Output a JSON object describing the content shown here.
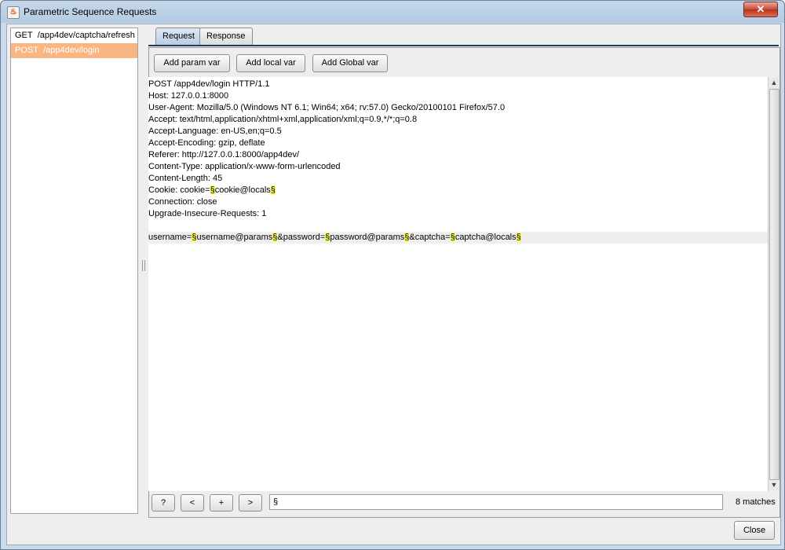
{
  "window": {
    "title": "Parametric Sequence Requests",
    "close_glyph": "✕"
  },
  "requests": [
    {
      "method": "GET",
      "path": "/app4dev/captcha/refresh",
      "selected": false
    },
    {
      "method": "POST",
      "path": "/app4dev/login",
      "selected": true
    }
  ],
  "tabs": [
    "Request",
    "Response"
  ],
  "active_tab": "Request",
  "buttons": {
    "add_param": "Add param var",
    "add_local": "Add local var",
    "add_global": "Add Global var"
  },
  "request_lines": [
    "POST /app4dev/login HTTP/1.1",
    "Host: 127.0.0.1:8000",
    "User-Agent: Mozilla/5.0 (Windows NT 6.1; Win64; x64; rv:57.0) Gecko/20100101 Firefox/57.0",
    "Accept: text/html,application/xhtml+xml,application/xml;q=0.9,*/*;q=0.8",
    "Accept-Language: en-US,en;q=0.5",
    "Accept-Encoding: gzip, deflate",
    "Referer: http://127.0.0.1:8000/app4dev/",
    "Content-Type: application/x-www-form-urlencoded",
    "Content-Length: 45",
    "Cookie: cookie=§cookie@locals§",
    "Connection: close",
    "Upgrade-Insecure-Requests: 1",
    "",
    "username=§username@params§&password=§password@params§&captcha=§captcha@locals§"
  ],
  "highlight_line_index": 13,
  "marker": "§",
  "search": {
    "help": "?",
    "prev": "<",
    "add": "+",
    "next": ">",
    "value": "§",
    "matches": "8 matches"
  },
  "footer": {
    "close": "Close"
  },
  "colors": {
    "selected_row": "#f9b683",
    "marker_highlight": "#ffff5a",
    "title_close": "#c84a33"
  },
  "icons": {
    "app": "java-cup-icon",
    "scroll_up": "arrow-up-icon",
    "scroll_down": "arrow-down-icon"
  }
}
